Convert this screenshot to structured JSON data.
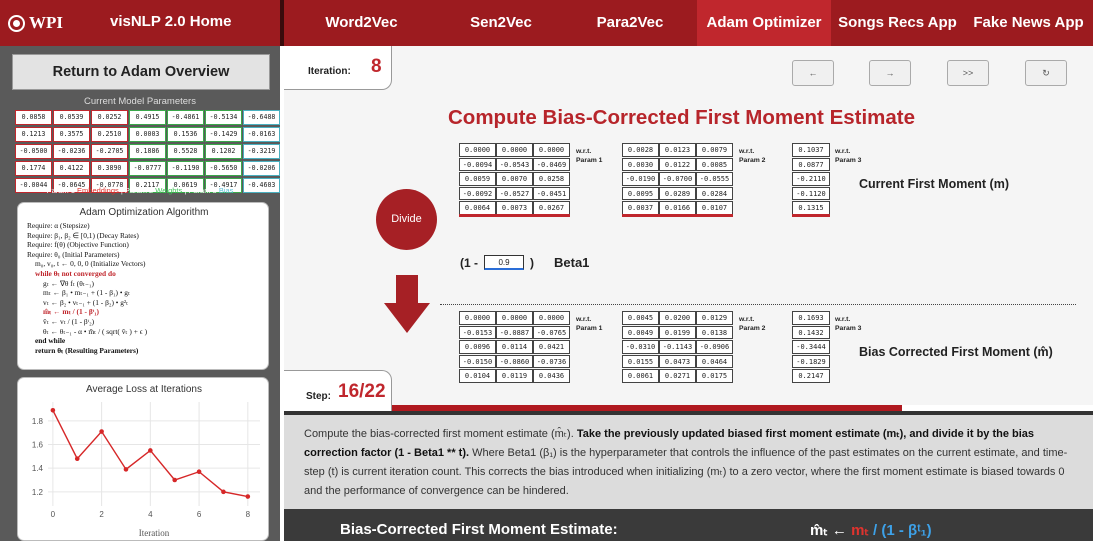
{
  "nav": {
    "logo": "WPI",
    "home": "visNLP 2.0 Home",
    "items": [
      "Word2Vec",
      "Sen2Vec",
      "Para2Vec",
      "Adam Optimizer",
      "Songs Recs App",
      "Fake News App"
    ],
    "active_index": 3
  },
  "sidebar": {
    "return_button": "Return to Adam Overview",
    "params_title": "Current Model Parameters",
    "param_rows": [
      [
        "0.0858",
        "0.0539",
        "0.0252",
        "0.4915",
        "-0.4861",
        "-0.5134",
        "-0.6488"
      ],
      [
        "0.1213",
        "0.3575",
        "0.2510",
        "0.0003",
        "0.1536",
        "-0.1429",
        "-0.0163"
      ],
      [
        "-0.0500",
        "-0.0236",
        "-0.2705",
        "0.1886",
        "0.5528",
        "0.1202",
        "-0.3219"
      ],
      [
        "0.1774",
        "0.4122",
        "0.3890",
        "-0.0777",
        "-0.1190",
        "-0.5650",
        "-0.0206"
      ],
      [
        "-0.0044",
        "-0.0645",
        "-0.0778",
        "0.2117",
        "0.0619",
        "-0.4917",
        "-0.4603"
      ]
    ],
    "legend": {
      "p1": "Param 1",
      "p1_term": "Embeddings",
      "sep1": " | Param 2 ",
      "p2_term": "Weights",
      "sep2": " | Param 3 ",
      "p3_term": "Bias"
    },
    "algorithm": {
      "title": "Adam Optimization Algorithm",
      "lines": [
        "Require: α  (Stepsize)",
        "Require: β₁, β₂ ∈ [0,1)  (Decay Rates)",
        "Require: f(θ)  (Objective Function)",
        "Require: θ₀  (Initial Parameters)",
        "m₀, v₀, t ← 0, 0, 0  (Initialize Vectors)",
        "while θₜ not converged do",
        "gₜ ← ∇θ fₜ (θₜ₋₁)",
        "mₜ ← β₁ • mₜ₋₁ + (1 - β₁) • gₜ",
        "vₜ ← β₂ • vₜ₋₁ + (1 - β₂) • g²ₜ",
        "m̂ₜ ← mₜ / (1 - βᵗ₁)",
        "v̂ₜ ← vₜ / (1 - βᵗ₂)",
        "θₜ ← θₜ₋₁ - α • m̂ₜ / ( sqrt( v̂ₜ ) + ϵ )",
        "end while",
        "return θₜ  (Resulting Parameters)"
      ]
    },
    "loss": {
      "title": "Average Loss at Iterations",
      "xlabel": "Iteration"
    }
  },
  "chart_data": {
    "type": "line",
    "title": "Average Loss at Iterations",
    "xlabel": "Iteration",
    "ylabel": "",
    "x": [
      0,
      1,
      2,
      3,
      4,
      5,
      6,
      7,
      8
    ],
    "y": [
      1.89,
      1.48,
      1.71,
      1.39,
      1.55,
      1.3,
      1.37,
      1.2,
      1.16
    ],
    "xlim": [
      -0.2,
      8.5
    ],
    "ylim": [
      1.08,
      1.96
    ],
    "xticks": [
      0,
      2,
      4,
      6,
      8
    ],
    "yticks": [
      1.2,
      1.4,
      1.6,
      1.8
    ],
    "grid": true,
    "color": "#d62728"
  },
  "main": {
    "iteration_label": "Iteration:",
    "iteration_value": "8",
    "controls": [
      "←",
      "→",
      ">>",
      "↻"
    ],
    "title": "Compute Bias-Corrected First Moment Estimate",
    "divide": "Divide",
    "beta_prefix": "(1 -",
    "beta_value": "0.9",
    "beta_suffix": ")",
    "beta_name": "Beta1",
    "wrt": "w.r.t.",
    "param_labels": [
      "Param 1",
      "Param 2",
      "Param 3"
    ],
    "current_label": "Current First Moment (m)",
    "corrected_label": "Bias Corrected First Moment (m̂)",
    "m_p1": [
      [
        "0.0000",
        "0.0000",
        "0.0000"
      ],
      [
        "-0.0094",
        "-0.0543",
        "-0.0469"
      ],
      [
        "0.0059",
        "0.0070",
        "0.0258"
      ],
      [
        "-0.0092",
        "-0.0527",
        "-0.0451"
      ],
      [
        "0.0064",
        "0.0073",
        "0.0267"
      ]
    ],
    "m_p2": [
      [
        "0.0028",
        "0.0123",
        "0.0079"
      ],
      [
        "0.0030",
        "0.0122",
        "0.0085"
      ],
      [
        "-0.0190",
        "-0.0700",
        "-0.0555"
      ],
      [
        "0.0095",
        "0.0289",
        "0.0284"
      ],
      [
        "0.0037",
        "0.0166",
        "0.0107"
      ]
    ],
    "m_p3": [
      [
        "0.1037"
      ],
      [
        "0.0877"
      ],
      [
        "-0.2110"
      ],
      [
        "-0.1120"
      ],
      [
        "0.1315"
      ]
    ],
    "mh_p1": [
      [
        "0.0000",
        "0.0000",
        "0.0000"
      ],
      [
        "-0.0153",
        "-0.0887",
        "-0.0765"
      ],
      [
        "0.0096",
        "0.0114",
        "0.0421"
      ],
      [
        "-0.0150",
        "-0.0860",
        "-0.0736"
      ],
      [
        "0.0104",
        "0.0119",
        "0.0436"
      ]
    ],
    "mh_p2": [
      [
        "0.0045",
        "0.0200",
        "0.0129"
      ],
      [
        "0.0049",
        "0.0199",
        "0.0138"
      ],
      [
        "-0.0310",
        "-0.1143",
        "-0.0906"
      ],
      [
        "0.0155",
        "0.0473",
        "0.0464"
      ],
      [
        "0.0061",
        "0.0271",
        "0.0175"
      ]
    ],
    "mh_p3": [
      [
        "0.1693"
      ],
      [
        "0.1432"
      ],
      [
        "-0.3444"
      ],
      [
        "-0.1829"
      ],
      [
        "0.2147"
      ]
    ],
    "step_label": "Step:",
    "step_value": "16/22",
    "step_fraction": 0.727
  },
  "description": {
    "p1": "Compute the bias-corrected first moment estimate (m̂ₜ). ",
    "b1": "Take the previously updated biased first moment estimate (mₜ), and divide it by the bias correction factor (1 - Beta1 ** t).",
    "p2": " Where Beta1 (β₁) is the hyperparameter that controls the influence of the past estimates on the current estimate, and time-step (t) is current iteration count. This corrects the bias introduced when initializing (mₜ) to a zero vector, where the first moment estimate is biased towards 0 and the performance of convergence can be hindered."
  },
  "formula": {
    "label": "Bias-Corrected First Moment Estimate:",
    "lhs": "m̂ₜ ← ",
    "mid": "mₜ",
    "rhs": " / (1 - βᵗ₁)"
  }
}
